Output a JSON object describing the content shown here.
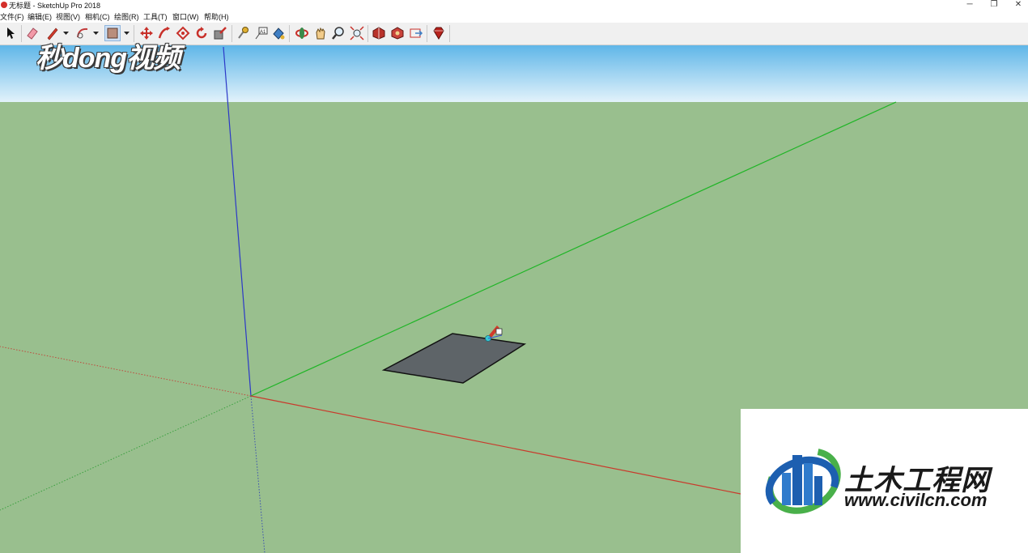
{
  "window": {
    "title": "无标题 - SketchUp Pro 2018",
    "controls": {
      "minimize": "─",
      "restore": "❐",
      "close": "✕"
    }
  },
  "menu": {
    "items": [
      "文件(F)",
      "编辑(E)",
      "视图(V)",
      "相机(C)",
      "绘图(R)",
      "工具(T)",
      "窗口(W)",
      "帮助(H)"
    ]
  },
  "toolbar": {
    "tools": [
      "select-icon",
      "eraser-icon",
      "pencil-line-icon",
      "arc-icon",
      "rectangle-icon",
      "move-icon",
      "push-pull-icon",
      "rotate-icon",
      "refresh-icon",
      "scale-icon",
      "tape-measure-icon",
      "text-icon",
      "paint-bucket-icon",
      "orbit-icon",
      "pan-icon",
      "zoom-icon",
      "zoom-extents-icon",
      "warehouse-icon",
      "extension-warehouse-icon",
      "send-to-layout-icon",
      "ruby-icon"
    ],
    "active_tool": "rectangle-icon"
  },
  "viewport": {
    "sky_color": "#bfe4f6",
    "ground_color": "#99bf8e",
    "face_color": "#5e6468"
  },
  "watermark": {
    "text": "秒dong视频"
  },
  "logo": {
    "name": "土木工程网",
    "url": "www.civilcn.com"
  }
}
